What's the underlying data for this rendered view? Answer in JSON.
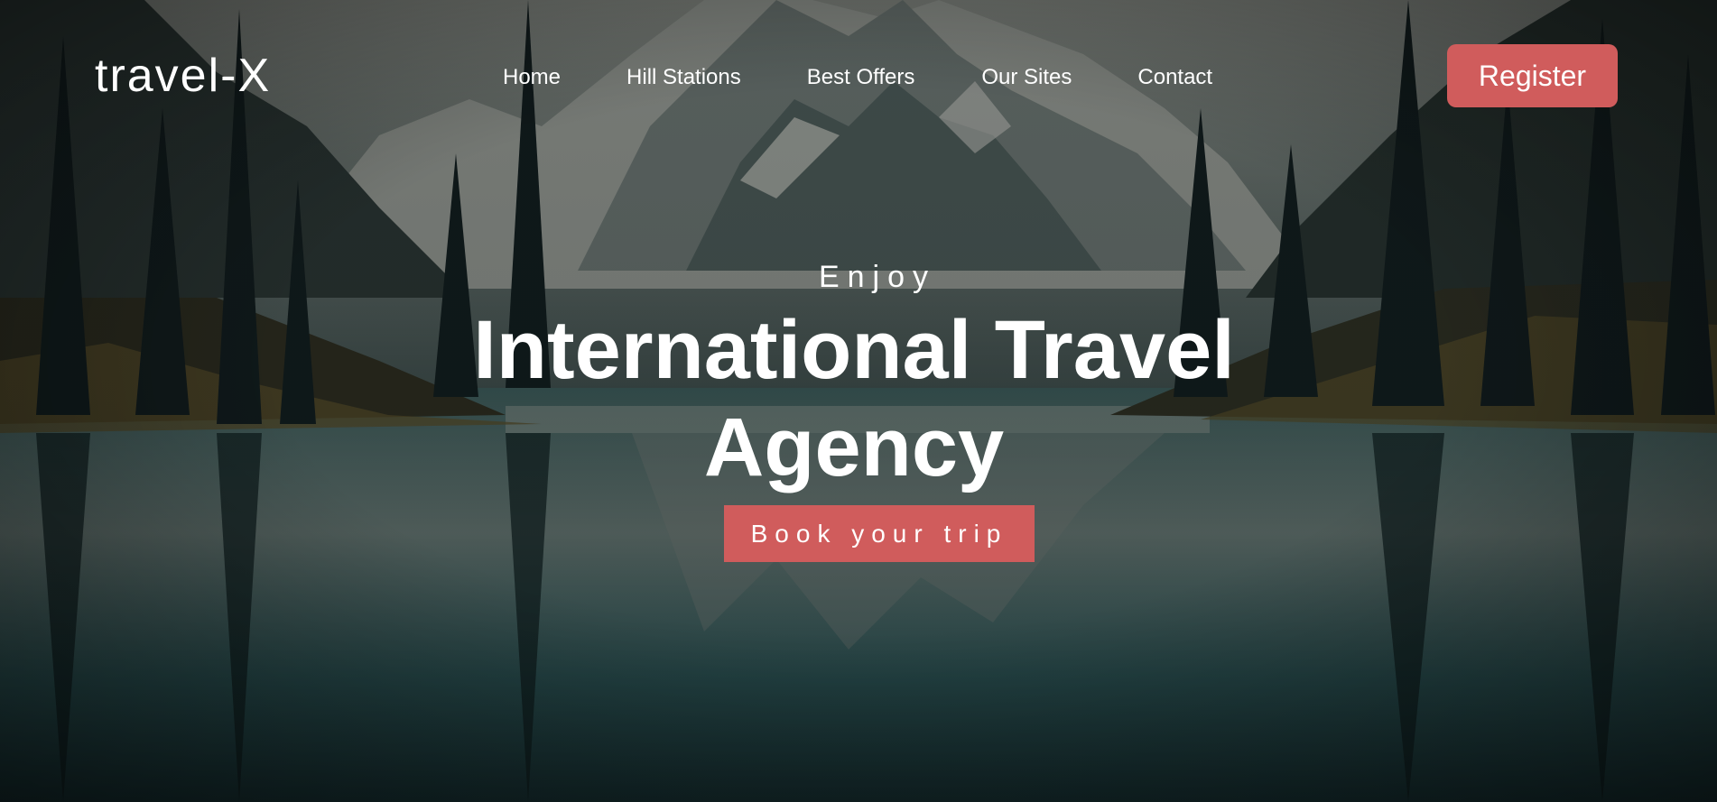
{
  "brand": {
    "logo_text": "travel-X"
  },
  "nav": {
    "items": [
      {
        "label": "Home"
      },
      {
        "label": "Hill Stations"
      },
      {
        "label": "Best Offers"
      },
      {
        "label": "Our Sites"
      },
      {
        "label": "Contact"
      }
    ],
    "register_label": "Register"
  },
  "hero": {
    "eyebrow": "Enjoy",
    "headline": "International Travel Agency",
    "cta_label": "Book your trip",
    "background_icon": "mountain-lake-landscape"
  },
  "colors": {
    "accent": "#d05c5c",
    "text": "#ffffff",
    "sky": "#7a7f78",
    "water": "#1f4548"
  }
}
